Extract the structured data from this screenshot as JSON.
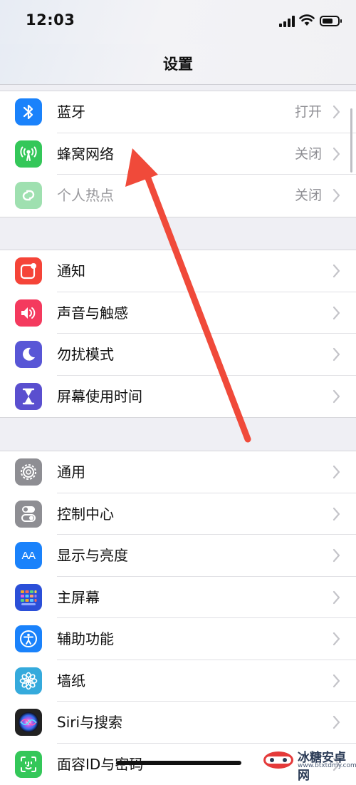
{
  "status_bar": {
    "time": "12:03"
  },
  "nav": {
    "title": "设置"
  },
  "groups": [
    [
      {
        "label": "蓝牙",
        "value": "打开",
        "icon": "bluetooth-icon",
        "color": "#1a82fb"
      },
      {
        "label": "蜂窝网络",
        "value": "关闭",
        "icon": "cellular-antenna-icon",
        "color": "#34c759"
      },
      {
        "label": "个人热点",
        "value": "关闭",
        "icon": "hotspot-chain-icon",
        "color": "#9fe0b0",
        "disabled": true
      }
    ],
    [
      {
        "label": "通知",
        "value": "",
        "icon": "notifications-icon",
        "color": "#f54438"
      },
      {
        "label": "声音与触感",
        "value": "",
        "icon": "speaker-icon",
        "color": "#f43a5e"
      },
      {
        "label": "勿扰模式",
        "value": "",
        "icon": "moon-icon",
        "color": "#5856d6"
      },
      {
        "label": "屏幕使用时间",
        "value": "",
        "icon": "hourglass-icon",
        "color": "#5a4fcf"
      }
    ],
    [
      {
        "label": "通用",
        "value": "",
        "icon": "gear-icon",
        "color": "#8e8e93"
      },
      {
        "label": "控制中心",
        "value": "",
        "icon": "toggles-icon",
        "color": "#8e8e93"
      },
      {
        "label": "显示与亮度",
        "value": "",
        "icon": "text-size-icon",
        "color": "#1a82fb"
      },
      {
        "label": "主屏幕",
        "value": "",
        "icon": "home-grid-icon",
        "color": "#2b4fd8"
      },
      {
        "label": "辅助功能",
        "value": "",
        "icon": "accessibility-icon",
        "color": "#1a82fb"
      },
      {
        "label": "墙纸",
        "value": "",
        "icon": "flower-icon",
        "color": "#35aadc"
      },
      {
        "label": "Siri与搜索",
        "value": "",
        "icon": "siri-icon",
        "color": "#222222"
      },
      {
        "label": "面容ID与密码",
        "value": "",
        "icon": "face-id-icon",
        "color": "#34c759"
      }
    ]
  ],
  "display_icon_text": "AA",
  "watermark": {
    "name": "冰糖安卓网",
    "url": "www.btxtdmy.com"
  },
  "annotation": {
    "color": "#f04a3a"
  }
}
